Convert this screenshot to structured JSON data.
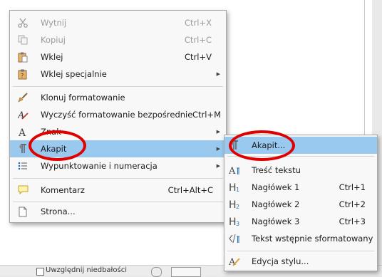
{
  "statusbar": {
    "text": "Uwzględnij niedbałości"
  },
  "context_menu": {
    "items": [
      {
        "label": "Wytnij",
        "shortcut": "Ctrl+X",
        "icon": "scissors-icon",
        "disabled": true
      },
      {
        "label": "Kopiuj",
        "shortcut": "Ctrl+C",
        "icon": "copy-icon",
        "disabled": true
      },
      {
        "label": "Wklej",
        "shortcut": "Ctrl+V",
        "icon": "paste-icon"
      },
      {
        "label": "Wklej specjalnie",
        "shortcut": "",
        "icon": "paste-special-icon",
        "submenu": true
      },
      {
        "label": "Klonuj formatowanie",
        "shortcut": "",
        "icon": "clone-formatting-icon"
      },
      {
        "label": "Wyczyść formatowanie bezpośrednie",
        "shortcut": "Ctrl+M",
        "icon": "clear-formatting-icon"
      },
      {
        "label": "Znak",
        "shortcut": "",
        "icon": "character-icon",
        "submenu": true
      },
      {
        "label": "Akapit",
        "shortcut": "",
        "icon": "paragraph-icon",
        "submenu": true,
        "highlighted": true
      },
      {
        "label": "Wypunktowanie i numeracja",
        "shortcut": "",
        "icon": "bullets-numbering-icon",
        "submenu": true
      },
      {
        "label": "Komentarz",
        "shortcut": "Ctrl+Alt+C",
        "icon": "comment-icon"
      },
      {
        "label": "Strona...",
        "shortcut": "",
        "icon": "page-icon"
      }
    ]
  },
  "submenu": {
    "items": [
      {
        "label": "Akapit...",
        "shortcut": "",
        "icon": "paragraph-dialog-icon",
        "highlighted": true
      },
      {
        "label": "Treść tekstu",
        "shortcut": "",
        "icon": "text-body-icon"
      },
      {
        "label": "Nagłówek 1",
        "shortcut": "Ctrl+1",
        "icon": "heading-1-icon"
      },
      {
        "label": "Nagłówek 2",
        "shortcut": "Ctrl+2",
        "icon": "heading-2-icon"
      },
      {
        "label": "Nagłówek 3",
        "shortcut": "Ctrl+3",
        "icon": "heading-3-icon"
      },
      {
        "label": "Tekst wstępnie sformatowany",
        "shortcut": "",
        "icon": "preformatted-text-icon"
      },
      {
        "label": "Edycja stylu...",
        "shortcut": "",
        "icon": "edit-style-icon"
      }
    ]
  },
  "colors": {
    "highlight": "#99c9ef",
    "annotation": "#e00000",
    "menu_bg": "#f8f8f8"
  }
}
